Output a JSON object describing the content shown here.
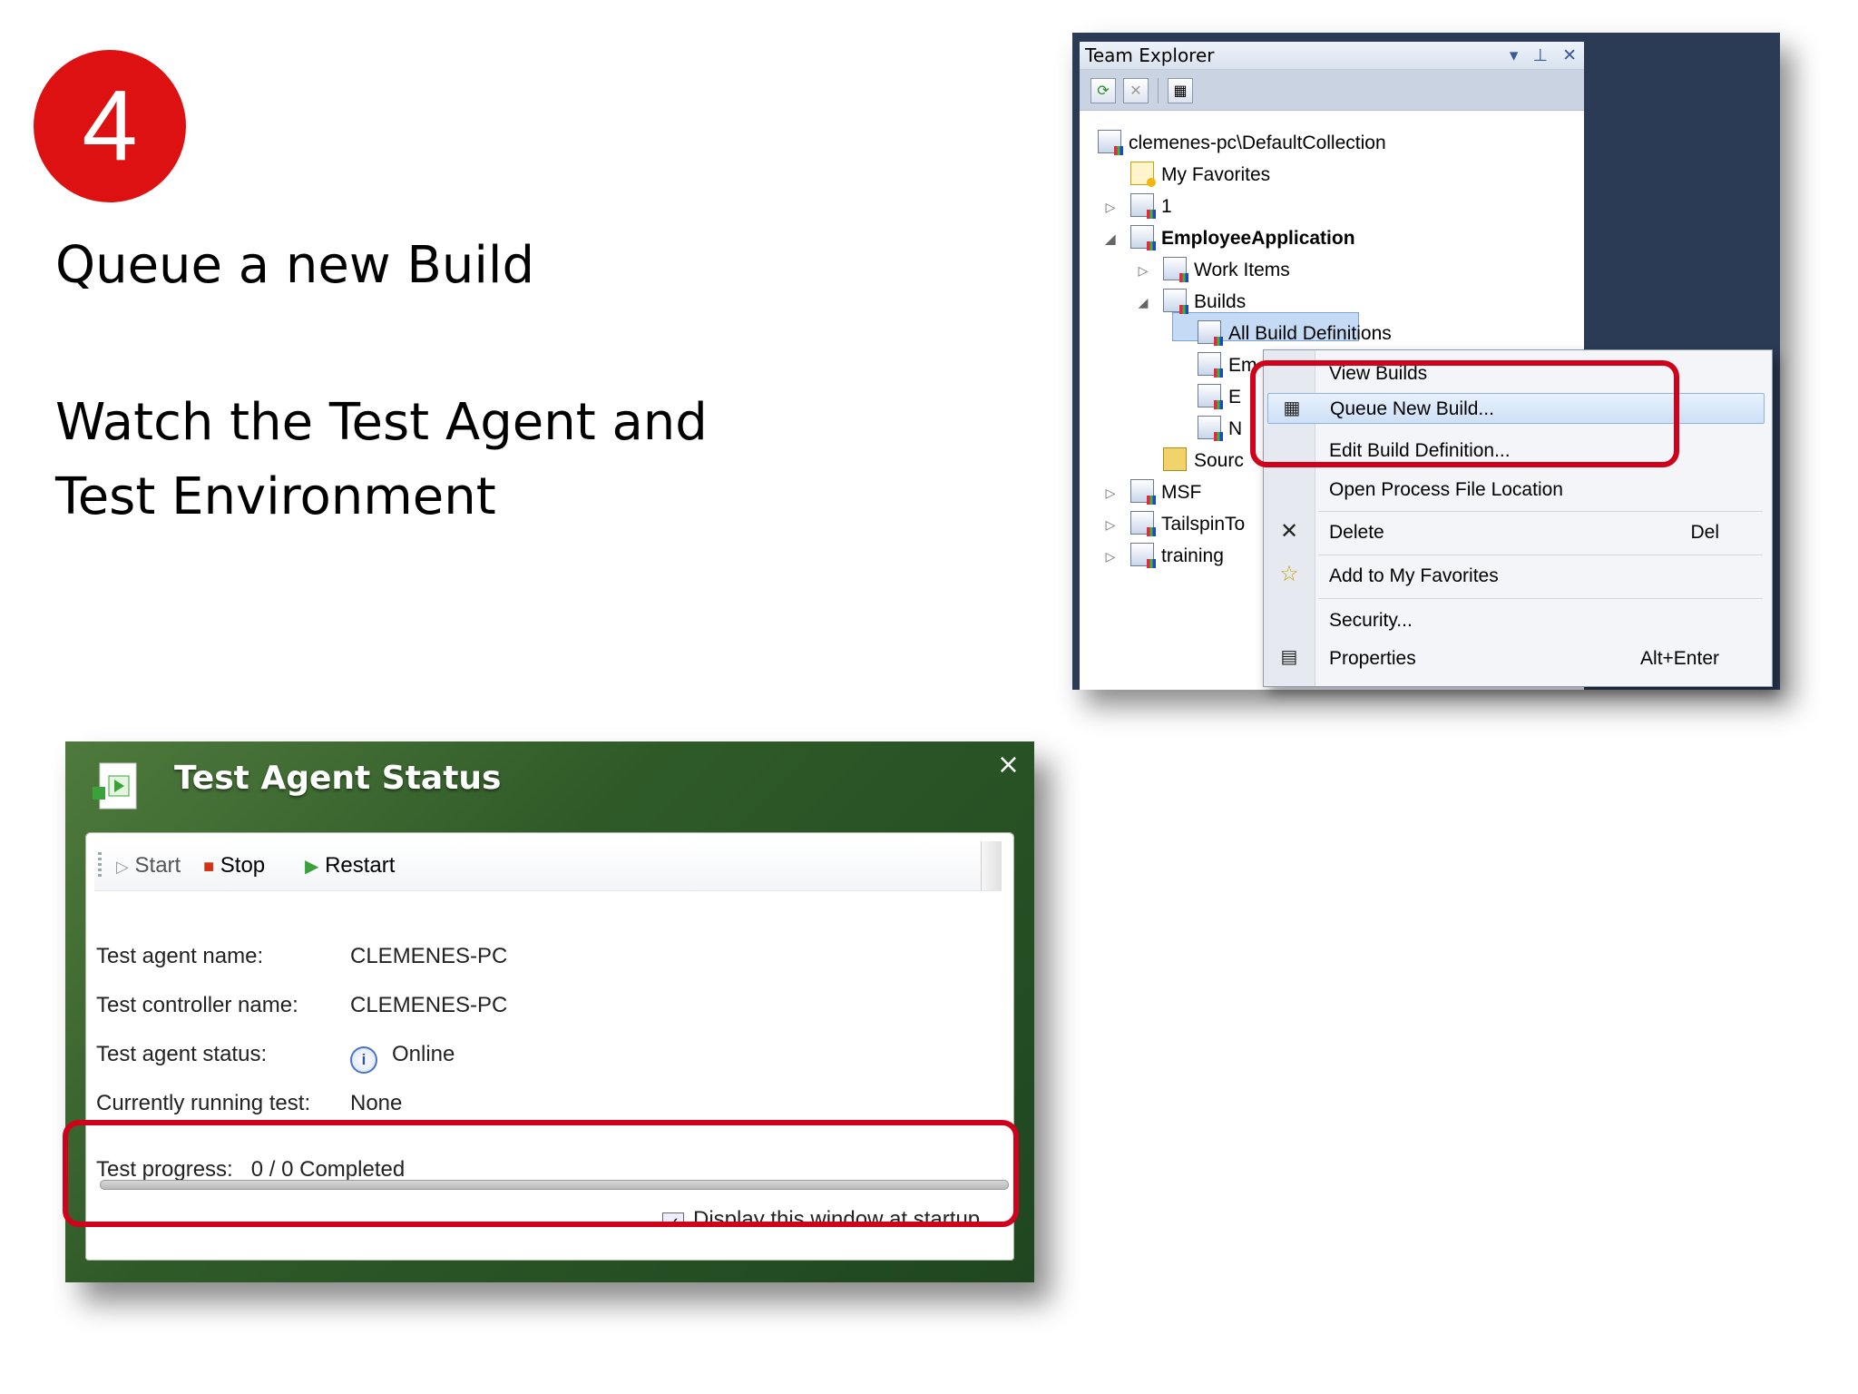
{
  "slide": {
    "step_number": "4",
    "heading": "Queue a new Build",
    "subheading": "Watch the Test Agent and Test Environment"
  },
  "team_explorer": {
    "title": "Team Explorer",
    "title_buttons": {
      "dropdown": "▾",
      "pin": "⊥",
      "close": "✕"
    },
    "toolbar_icons": [
      "refresh-icon",
      "stop-icon",
      "add-team-project-icon"
    ],
    "tree": {
      "collection": "clemenes-pc\\DefaultCollection",
      "favorites": "My Favorites",
      "project_1": "1",
      "project_employee": "EmployeeApplication",
      "work_items": "Work Items",
      "builds": "Builds",
      "all_build_definitions": "All Build Definitions",
      "build_def_1": "Em",
      "build_def_2": "E",
      "build_def_3": "N",
      "source_control": "Sourc",
      "msf": "MSF",
      "tailspin": "TailspinTo",
      "training": "training"
    }
  },
  "context_menu": {
    "view_builds": "View Builds",
    "queue_new_build": "Queue New Build...",
    "edit_build_definition": "Edit Build Definition...",
    "open_process_file_location": "Open Process File Location",
    "delete": "Delete",
    "delete_shortcut": "Del",
    "add_to_favorites": "Add to My Favorites",
    "security": "Security...",
    "properties": "Properties",
    "properties_shortcut": "Alt+Enter"
  },
  "test_agent_status": {
    "title": "Test Agent Status",
    "close": "×",
    "toolbar": {
      "start": "Start",
      "stop": "Stop",
      "restart": "Restart"
    },
    "agent_name_label": "Test agent name:",
    "agent_name_value": "CLEMENES-PC",
    "controller_name_label": "Test controller name:",
    "controller_name_value": "CLEMENES-PC",
    "agent_status_label": "Test agent status:",
    "agent_status_value": "Online",
    "running_test_label": "Currently running test:",
    "running_test_value": "None",
    "progress_label": "Test progress:",
    "progress_value": "0 / 0 Completed",
    "progress_fraction": 0,
    "startup_checkbox_label": "Display this window at startup",
    "startup_checkbox_checked": true
  },
  "colors": {
    "badge_red": "#dd1111",
    "highlight_red": "#d0021b",
    "agent_window_green": "#2f5a28",
    "explorer_frame": "#2b3a55"
  }
}
